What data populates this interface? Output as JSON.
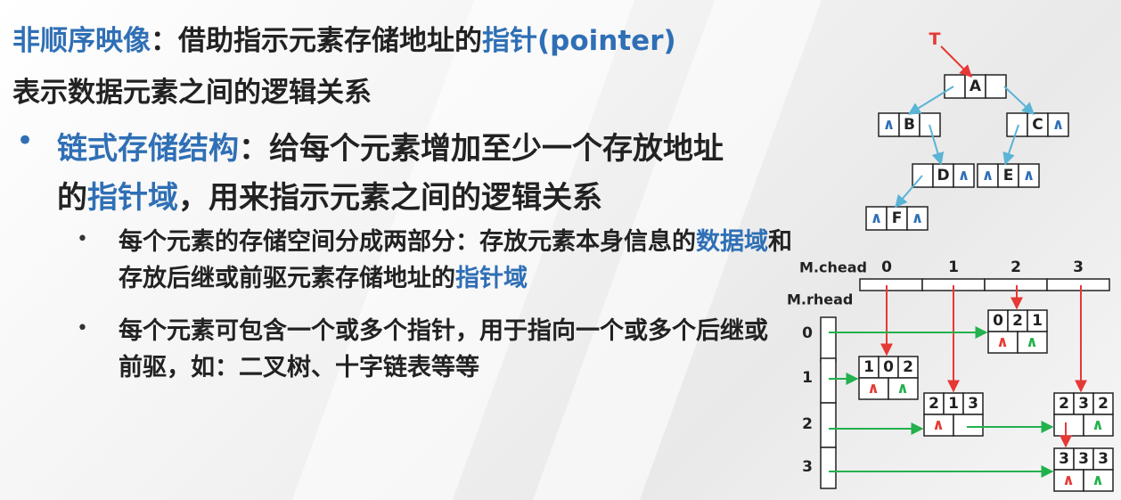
{
  "heading": {
    "term": "非顺序映像",
    "colon": "：",
    "desc1": "借助指示元素存储地址的",
    "pointer_term": "指针",
    "pointer_en": "(pointer)",
    "desc2": "表示数据元素之间的逻辑关系"
  },
  "bullet1": {
    "marker": "•",
    "term": "链式存储结构",
    "text1": "：给每个元素增加至少一个存放地址的",
    "term2": "指针域",
    "text2": "，用来指示元素之间的逻辑关系"
  },
  "bullet2": {
    "marker": "•",
    "text1": "每个元素的存储空间分成两部分：存放元素本身信息的",
    "term1": "数据域",
    "text2": "和存放后继或前驱元素存储地址的",
    "term2": "指针域"
  },
  "bullet3": {
    "marker": "•",
    "text": "每个元素可包含一个或多个指针，用于指向一个或多个后继或前驱，如：二叉树、十字链表等等"
  },
  "tree": {
    "root_label": "T",
    "null_mark": "∧",
    "nodes": {
      "A": "A",
      "B": "B",
      "C": "C",
      "D": "D",
      "E": "E",
      "F": "F"
    }
  },
  "ortho": {
    "chead_label": "M.chead",
    "rhead_label": "M.rhead",
    "col_indices": [
      "0",
      "1",
      "2",
      "3"
    ],
    "row_indices": [
      "0",
      "1",
      "2",
      "3"
    ],
    "null_mark": "∧",
    "nodes": [
      {
        "i": "0",
        "j": "2",
        "v": "1"
      },
      {
        "i": "1",
        "j": "0",
        "v": "2"
      },
      {
        "i": "2",
        "j": "1",
        "v": "3"
      },
      {
        "i": "2",
        "j": "3",
        "v": "2"
      },
      {
        "i": "3",
        "j": "3",
        "v": "3"
      }
    ]
  },
  "colors": {
    "blue_text": "#2f6fb5",
    "tree_arrow": "#5ab4d6",
    "root_arrow": "#e53935",
    "col_arrow": "#e53935",
    "row_arrow": "#22b14c",
    "null_blue": "#2f6fb5",
    "null_red": "#e53935",
    "null_green": "#22b14c"
  }
}
